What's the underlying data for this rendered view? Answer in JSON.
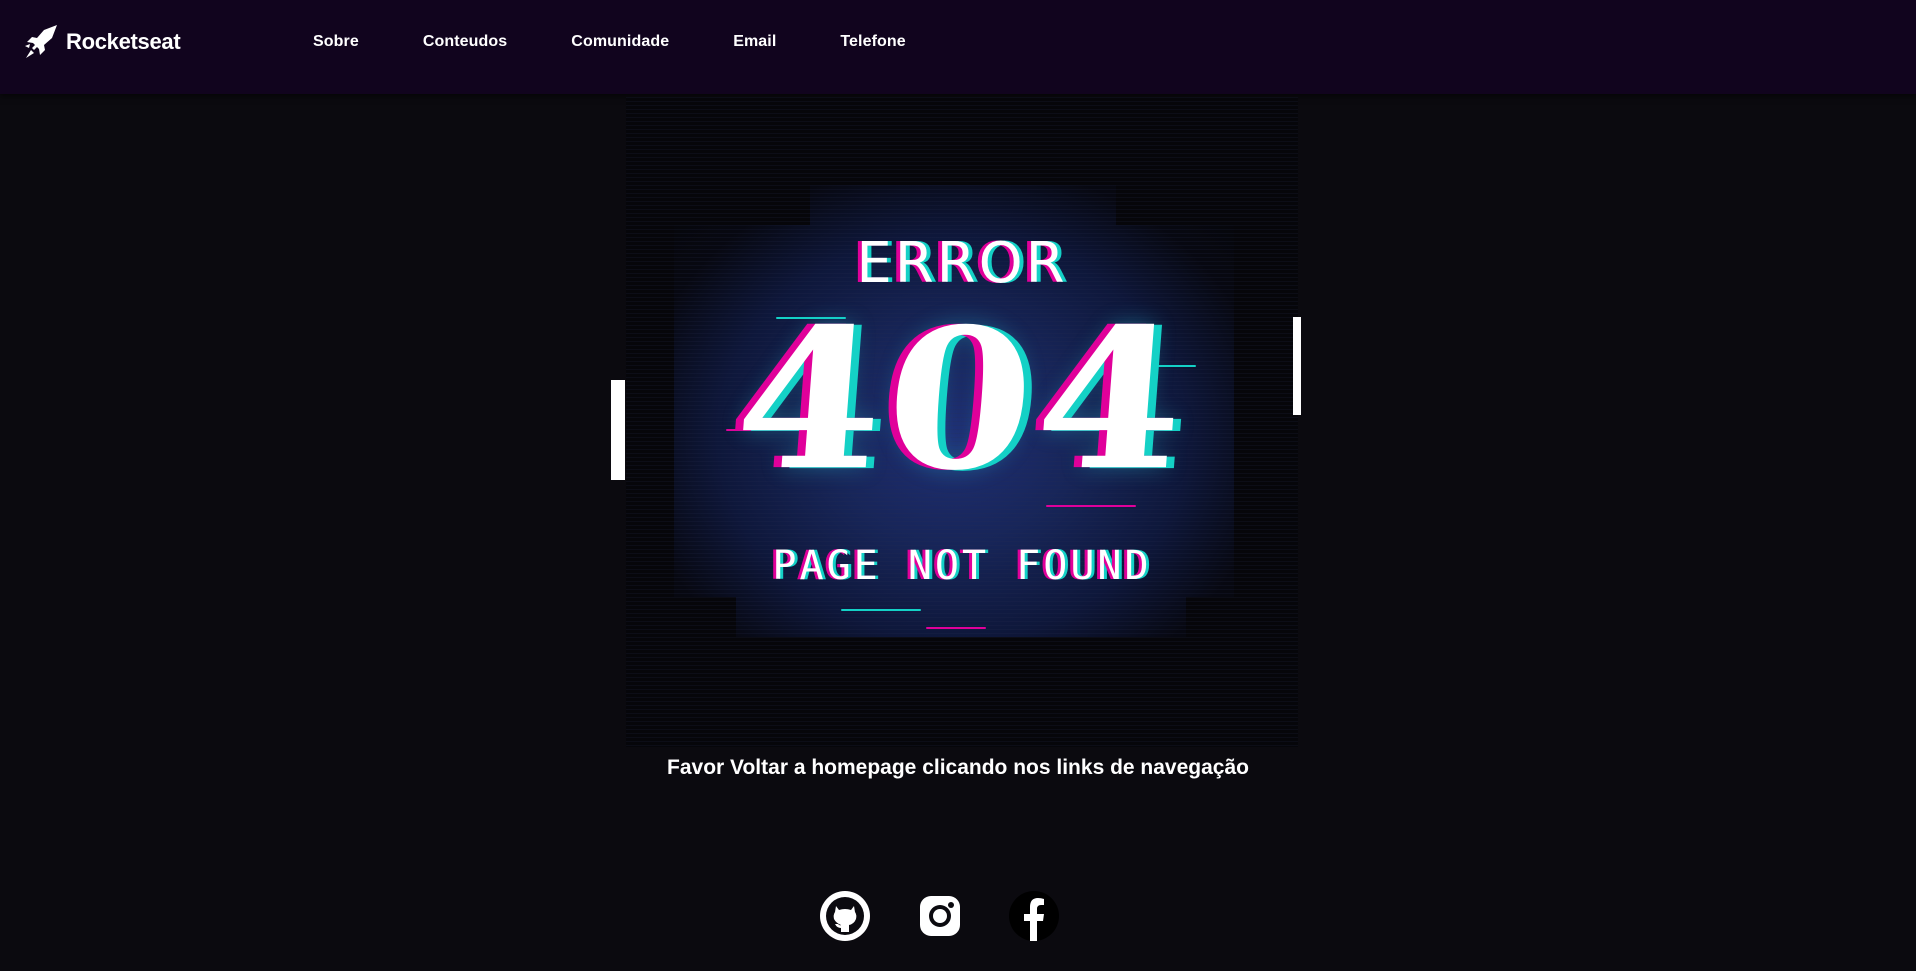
{
  "header": {
    "brand": "Rocketseat",
    "nav": [
      "Sobre",
      "Conteudos",
      "Comunidade",
      "Email",
      "Telefone"
    ]
  },
  "hero": {
    "error_text": "ERROR",
    "code_text": "404",
    "subtitle_text": "PAGE NOT FOUND"
  },
  "message": "Favor Voltar a homepage clicando nos links de navegação",
  "social": [
    "github-icon",
    "instagram-icon",
    "facebook-icon"
  ],
  "colors": {
    "header_bg": "#11041e",
    "page_bg": "#0b0a0f",
    "glitch_magenta": "#e0009a",
    "glitch_cyan": "#14d1c6",
    "text": "#ffffff"
  }
}
